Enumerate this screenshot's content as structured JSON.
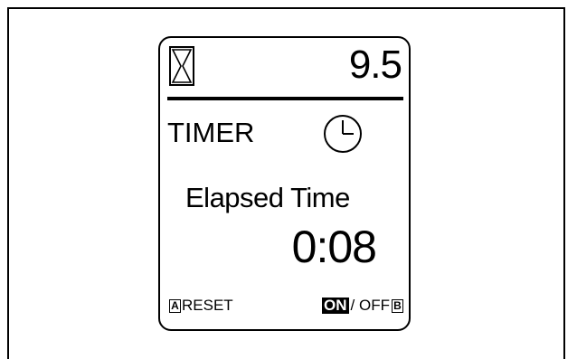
{
  "display": {
    "top_value": "9.5",
    "mode_label": "TIMER",
    "elapsed_label": "Elapsed Time",
    "elapsed_value": "0:08"
  },
  "soft_keys": {
    "left_key": "A",
    "left_label": "RESET",
    "right_on_label": "ON",
    "right_off_label": "/ OFF",
    "right_key": "B"
  },
  "icons": {
    "top_left": "hourglass-icon",
    "mode": "clock-icon"
  }
}
